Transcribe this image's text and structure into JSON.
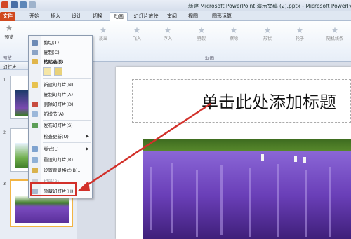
{
  "window": {
    "title": "新建 Microsoft PowerPoint 演示文稿 (2).pptx - Microsoft PowerPoint"
  },
  "ribbon_tabs": [
    {
      "label": "文件"
    },
    {
      "label": "开始"
    },
    {
      "label": "插入"
    },
    {
      "label": "设计"
    },
    {
      "label": "切换"
    },
    {
      "label": "动画"
    },
    {
      "label": "幻灯片放映"
    },
    {
      "label": "审阅"
    },
    {
      "label": "视图"
    },
    {
      "label": "图形运算"
    }
  ],
  "ribbon": {
    "preview_label": "预览",
    "preview_group": "预览",
    "animation_group": "动画",
    "animations": [
      "淡出",
      "飞入",
      "浮入",
      "劈裂",
      "擦除",
      "形状",
      "轮子",
      "随机线条"
    ]
  },
  "left_pane": {
    "header": "幻灯片",
    "slides": [
      {
        "number": "1"
      },
      {
        "number": "2"
      },
      {
        "number": "3"
      }
    ]
  },
  "slide": {
    "title_placeholder": "单击此处添加标题"
  },
  "context_menu": {
    "items": [
      {
        "label": "剪切(T)"
      },
      {
        "label": "复制(C)"
      },
      {
        "label": "粘贴选项:"
      },
      {
        "label": "新建幻灯片(N)"
      },
      {
        "label": "复制幻灯片(A)"
      },
      {
        "label": "删除幻灯片(D)"
      },
      {
        "label": "新增节(A)"
      },
      {
        "label": "发布幻灯片(S)"
      },
      {
        "label": "检查更新(U)"
      },
      {
        "label": "版式(L)"
      },
      {
        "label": "重设幻灯片(R)"
      },
      {
        "label": "设置背景格式(B)..."
      },
      {
        "label": "相册(P)..."
      },
      {
        "label": "隐藏幻灯片(H)"
      }
    ]
  },
  "colors": {
    "file_tab": "#d0491f",
    "highlight_box": "#d2302a",
    "annotation_arrow": "#d2302a"
  }
}
